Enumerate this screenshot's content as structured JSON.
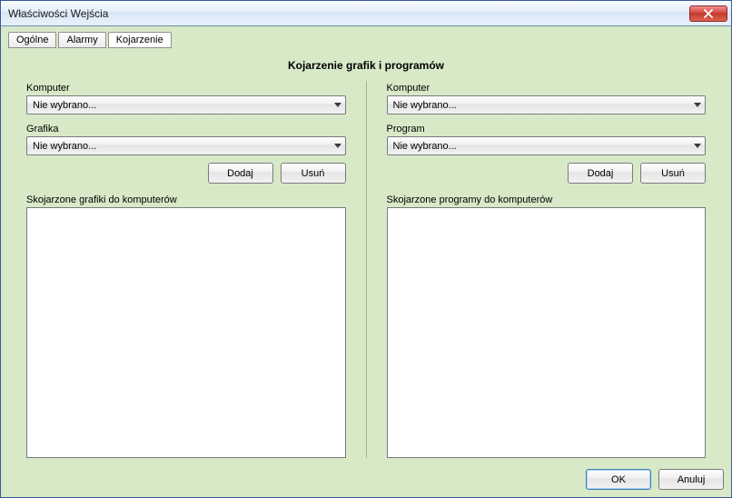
{
  "window": {
    "title": "Właściwości Wejścia"
  },
  "tabs": {
    "general": "Ogólne",
    "alarms": "Alarmy",
    "association": "Kojarzenie"
  },
  "heading": "Kojarzenie grafik i programów",
  "left": {
    "computer_label": "Komputer",
    "computer_value": "Nie wybrano...",
    "second_label": "Grafika",
    "second_value": "Nie wybrano...",
    "add_label": "Dodaj",
    "delete_label": "Usuń",
    "list_label": "Skojarzone grafiki do komputerów"
  },
  "right": {
    "computer_label": "Komputer",
    "computer_value": "Nie wybrano...",
    "second_label": "Program",
    "second_value": "Nie wybrano...",
    "add_label": "Dodaj",
    "delete_label": "Usuń",
    "list_label": "Skojarzone programy do komputerów"
  },
  "footer": {
    "ok": "OK",
    "cancel": "Anuluj"
  }
}
